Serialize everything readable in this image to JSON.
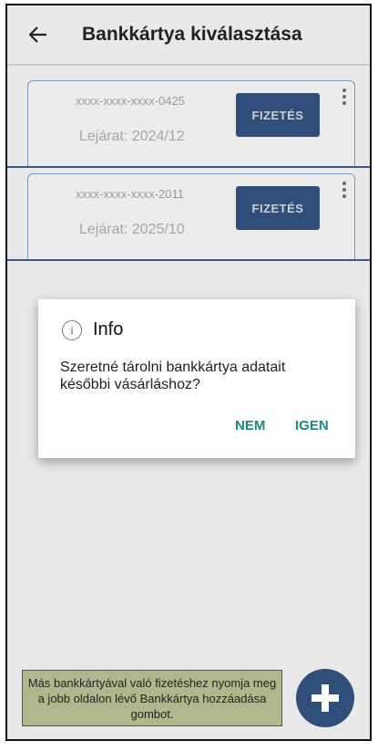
{
  "appbar": {
    "title": "Bankkártya kiválasztása",
    "back_icon": "arrow-left-icon"
  },
  "cards": [
    {
      "number": "xxxx-xxxx-xxxx-0425",
      "expiry": "Lejárat: 2024/12",
      "pay_label": "FIZETÉS"
    },
    {
      "number": "xxxx-xxxx-xxxx-2011",
      "expiry": "Lejárat: 2025/10",
      "pay_label": "FIZETÉS"
    }
  ],
  "dialog": {
    "icon": "info-icon",
    "title": "Info",
    "message": "Szeretné tárolni bankkártya adatait későbbi vásárláshoz?",
    "no_label": "NEM",
    "yes_label": "IGEN"
  },
  "hint": {
    "text": "Más bankkártyával való fizetéshez nyomja meg a jobb oldalon lévő Bankkártya hozzáadása gombot."
  },
  "fab": {
    "icon": "plus-icon"
  },
  "colors": {
    "primary": "#2f4f7a",
    "dialog_action": "#1a8a7c",
    "hint_bg": "#b1b78c",
    "background": "#e9e9e9"
  }
}
